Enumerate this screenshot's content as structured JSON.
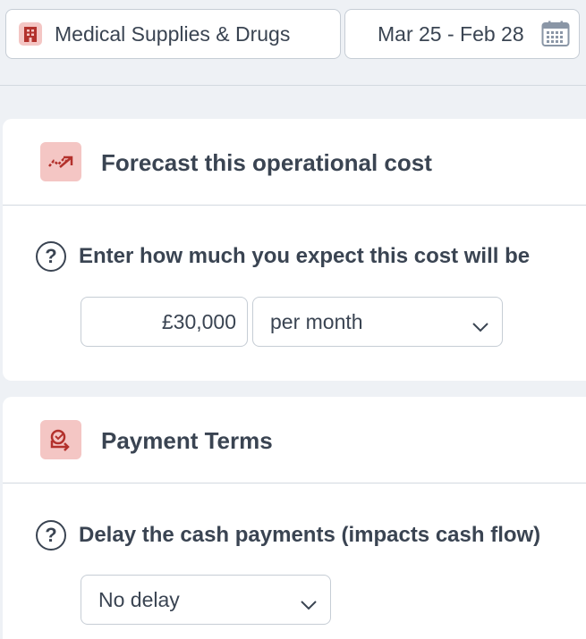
{
  "header": {
    "category": {
      "label": "Medical Supplies & Drugs",
      "icon": "building-icon"
    },
    "date_range": {
      "label": "Mar 25 - Feb 28",
      "icon": "calendar-icon"
    }
  },
  "forecast_card": {
    "title": "Forecast this operational cost",
    "icon": "trend-up-icon",
    "question": "Enter how much you expect this cost will be",
    "amount_value": "£30,000",
    "period_selected": "per month"
  },
  "payment_card": {
    "title": "Payment Terms",
    "icon": "payment-arrow-icon",
    "question": "Delay the cash payments (impacts cash flow)",
    "delay_selected": "No delay"
  },
  "colors": {
    "accent_bg": "#f4c6c4",
    "accent_icon": "#b3312c",
    "text": "#3a4452",
    "page_bg": "#eef1f5"
  }
}
